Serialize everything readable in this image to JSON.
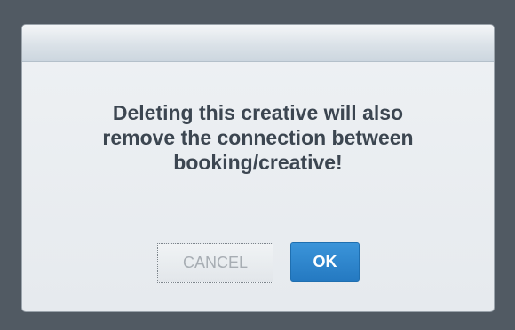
{
  "dialog": {
    "message_lines": [
      "Deleting this creative will also",
      "remove the connection between",
      "booking/creative!"
    ],
    "cancel_label": "CANCEL",
    "ok_label": "OK"
  },
  "colors": {
    "backdrop": "#515a63",
    "dialog_background": "#e6eaee",
    "message_text": "#3c4651",
    "ok_button": "#2a80c9",
    "cancel_text": "#a7adb3"
  }
}
